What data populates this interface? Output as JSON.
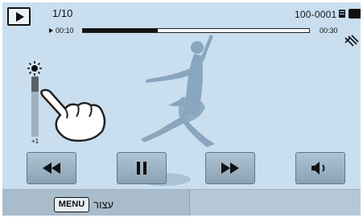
{
  "top_bar": {
    "file_counter": "1/10",
    "file_number": "100-0001"
  },
  "playback": {
    "elapsed_time": "00:10",
    "total_time": "00:30",
    "progress": 0.33
  },
  "brightness": {
    "value_label": "+1",
    "level": 0.75
  },
  "controls": {
    "rewind": "rewind-icon",
    "pause": "pause-icon",
    "fast_forward": "fast-forward-icon",
    "volume": "volume-icon"
  },
  "bottom_bar": {
    "menu_key": "MENU",
    "back_label": "עצור"
  },
  "colors": {
    "screen_background": "#c9dff0",
    "button_fill": "#9fb4c4",
    "figure_silhouette": "#8aa6be"
  }
}
